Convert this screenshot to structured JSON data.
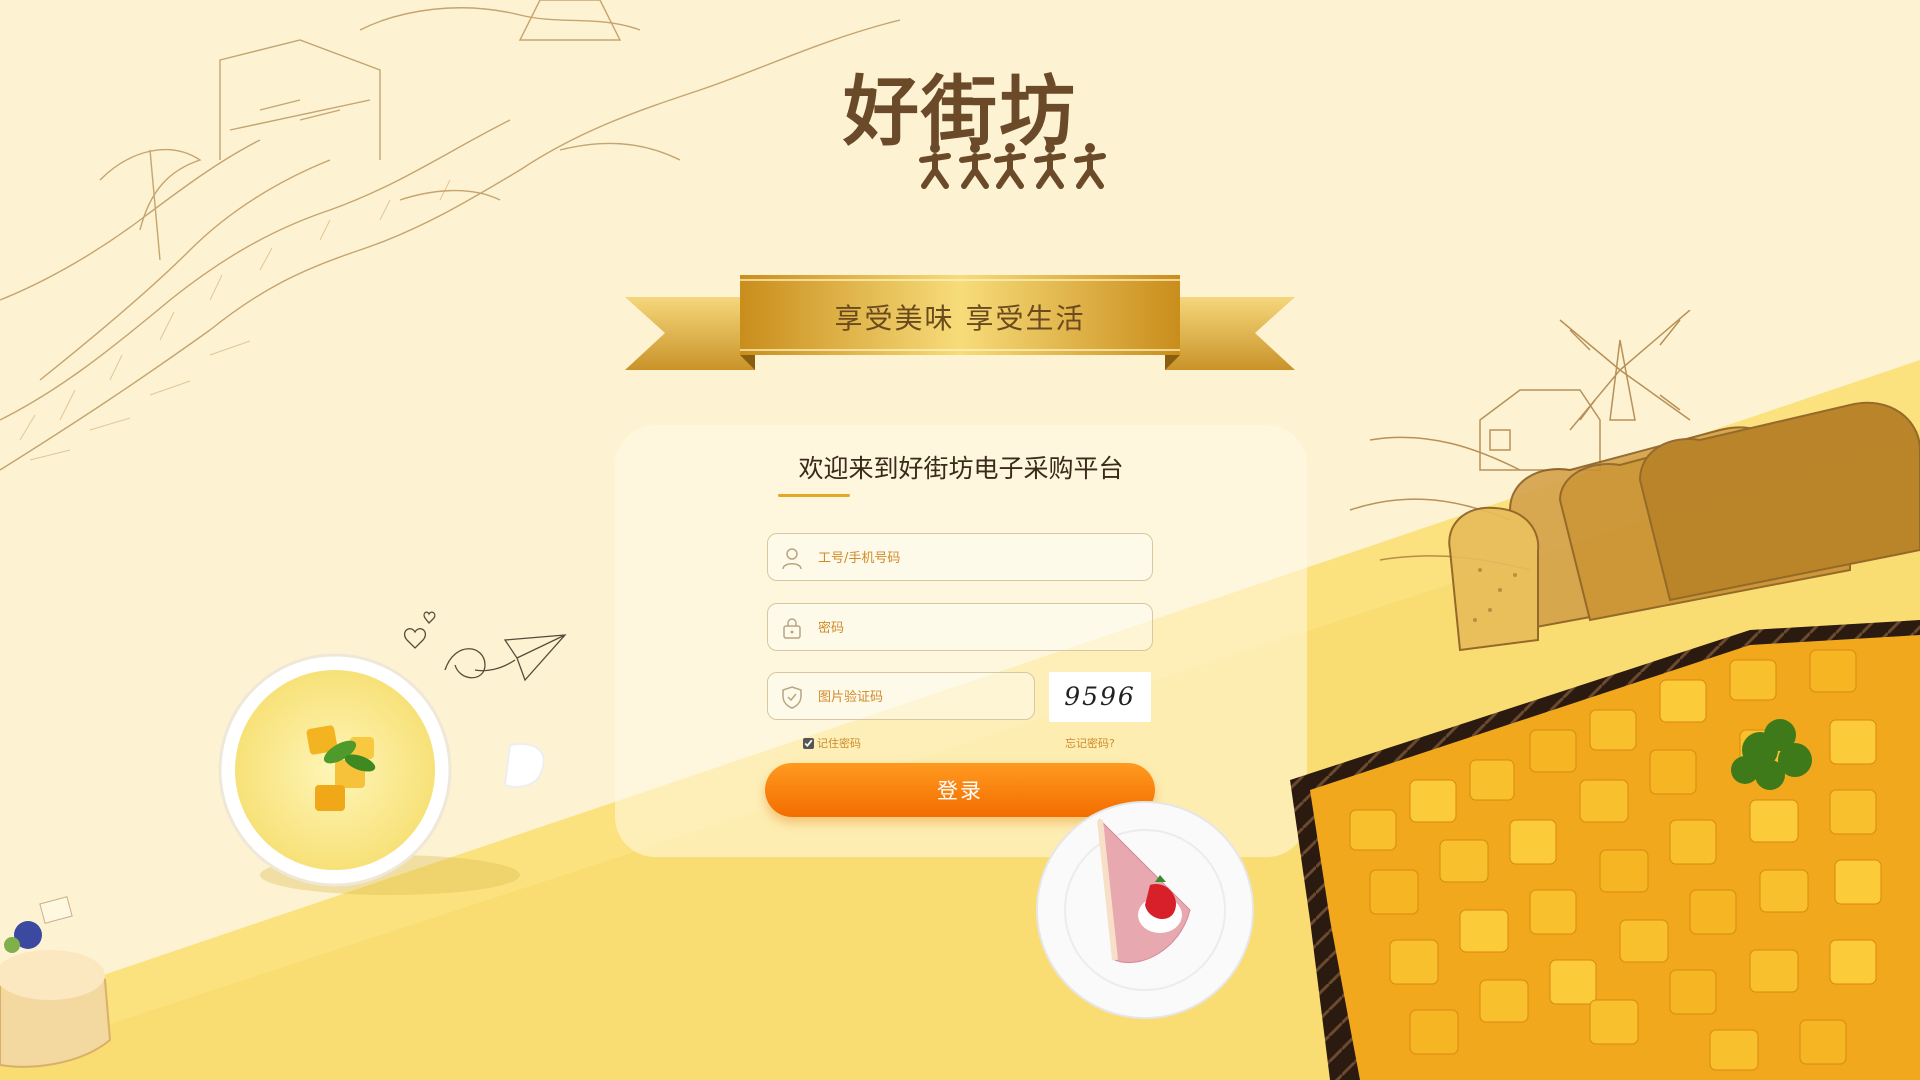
{
  "brand": {
    "name": "好街坊"
  },
  "ribbon": {
    "slogan": "享受美味 享受生活"
  },
  "login": {
    "title": "欢迎来到好街坊电子采购平台",
    "username_placeholder": "工号/手机号码",
    "password_placeholder": "密码",
    "captcha_placeholder": "图片验证码",
    "captcha_code": "9596",
    "remember_label": "记住密码",
    "remember_checked": true,
    "forgot_label": "忘记密码?",
    "submit_label": "登录"
  },
  "colors": {
    "background_light": "#fdf3d2",
    "background_yellow": "#fbe27e",
    "accent_orange": "#f36d00",
    "ribbon_gold": "#d9a632",
    "brand_brown": "#6b4a2a"
  }
}
